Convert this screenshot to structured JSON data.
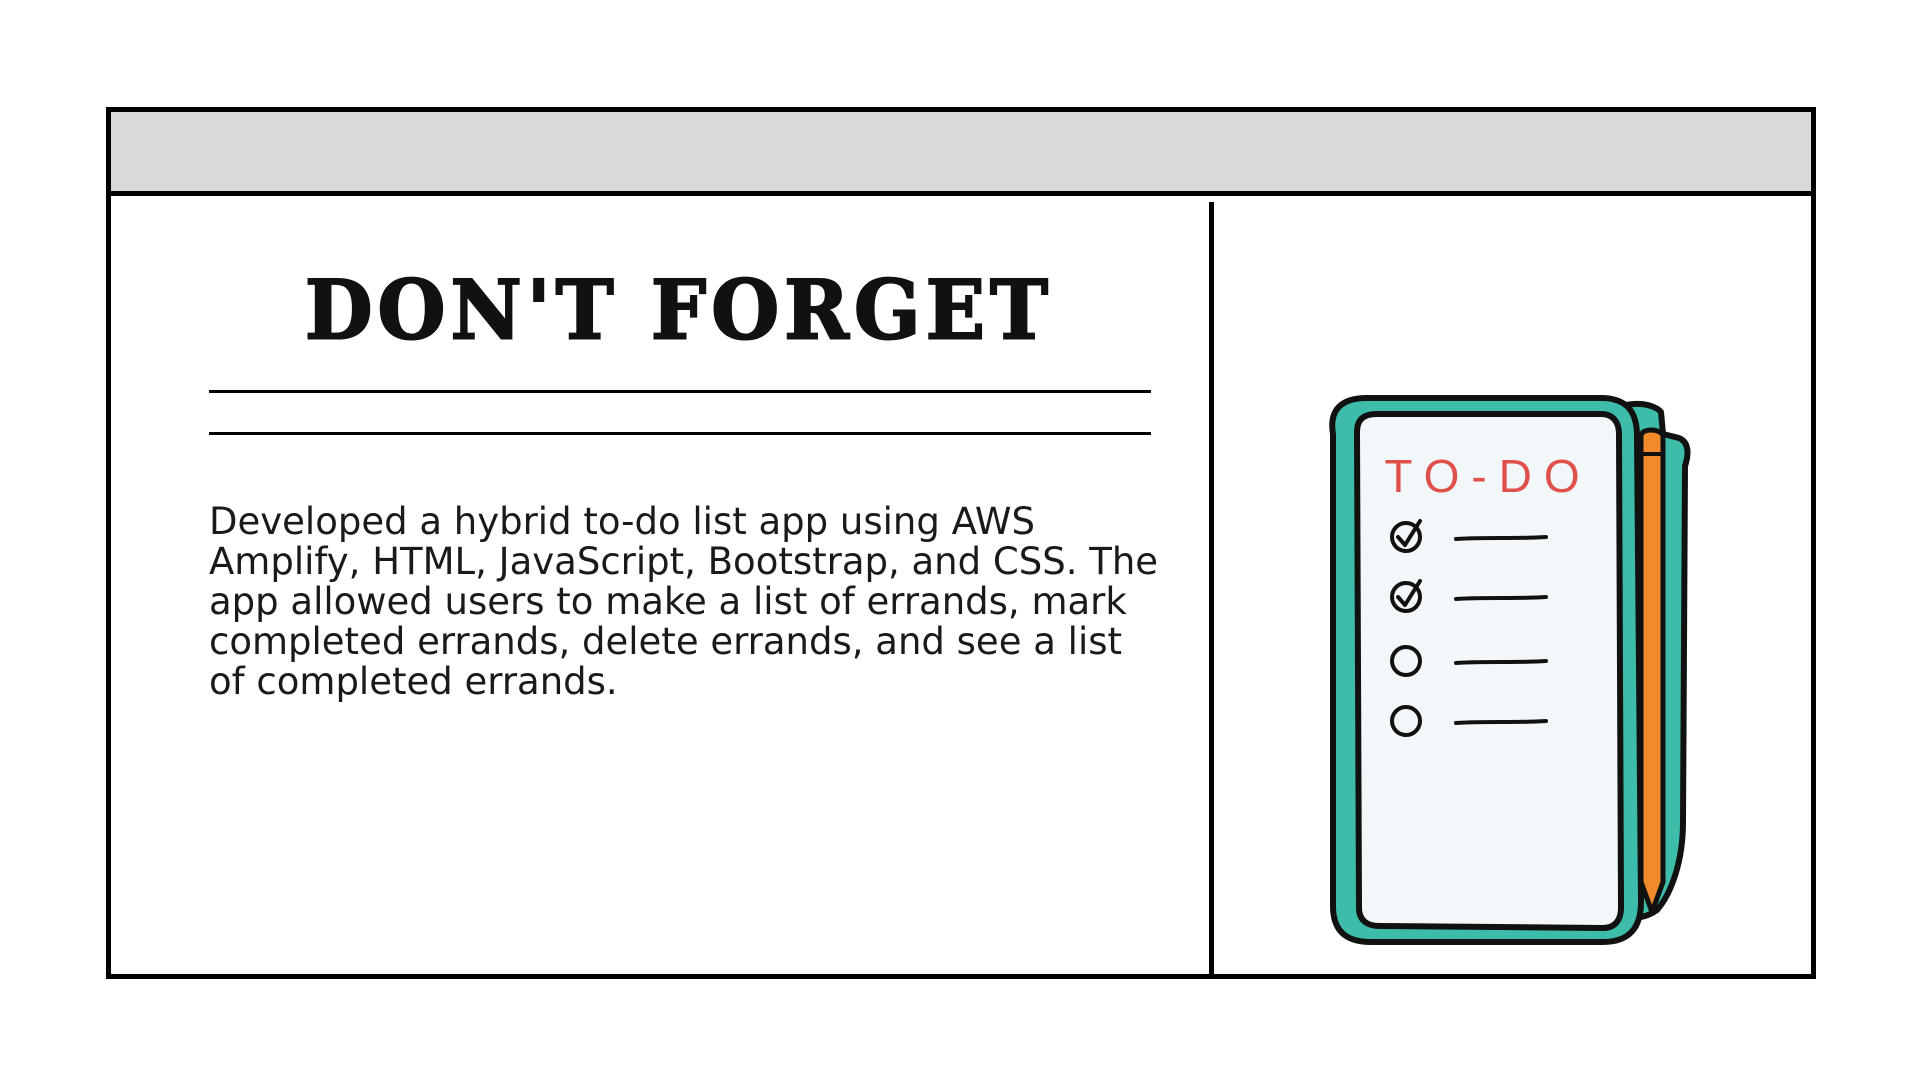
{
  "card": {
    "heading": "DON'T FORGET",
    "description": "Developed a hybrid to-do list app using AWS Amplify, HTML, JavaScript, Bootstrap, and CSS. The app allowed users to make a list of errands, mark completed errands, delete errands, and see a list of completed errands."
  },
  "illustration": {
    "label": "TO-DO",
    "icon": "clipboard-todo-icon",
    "items": [
      {
        "checked": true
      },
      {
        "checked": true
      },
      {
        "checked": false
      },
      {
        "checked": false
      }
    ],
    "colors": {
      "clipboard": "#3dbda9",
      "paper": "#f2f7fa",
      "label": "#e0504a",
      "pencil": "#f08a2a",
      "outline": "#111111"
    }
  }
}
